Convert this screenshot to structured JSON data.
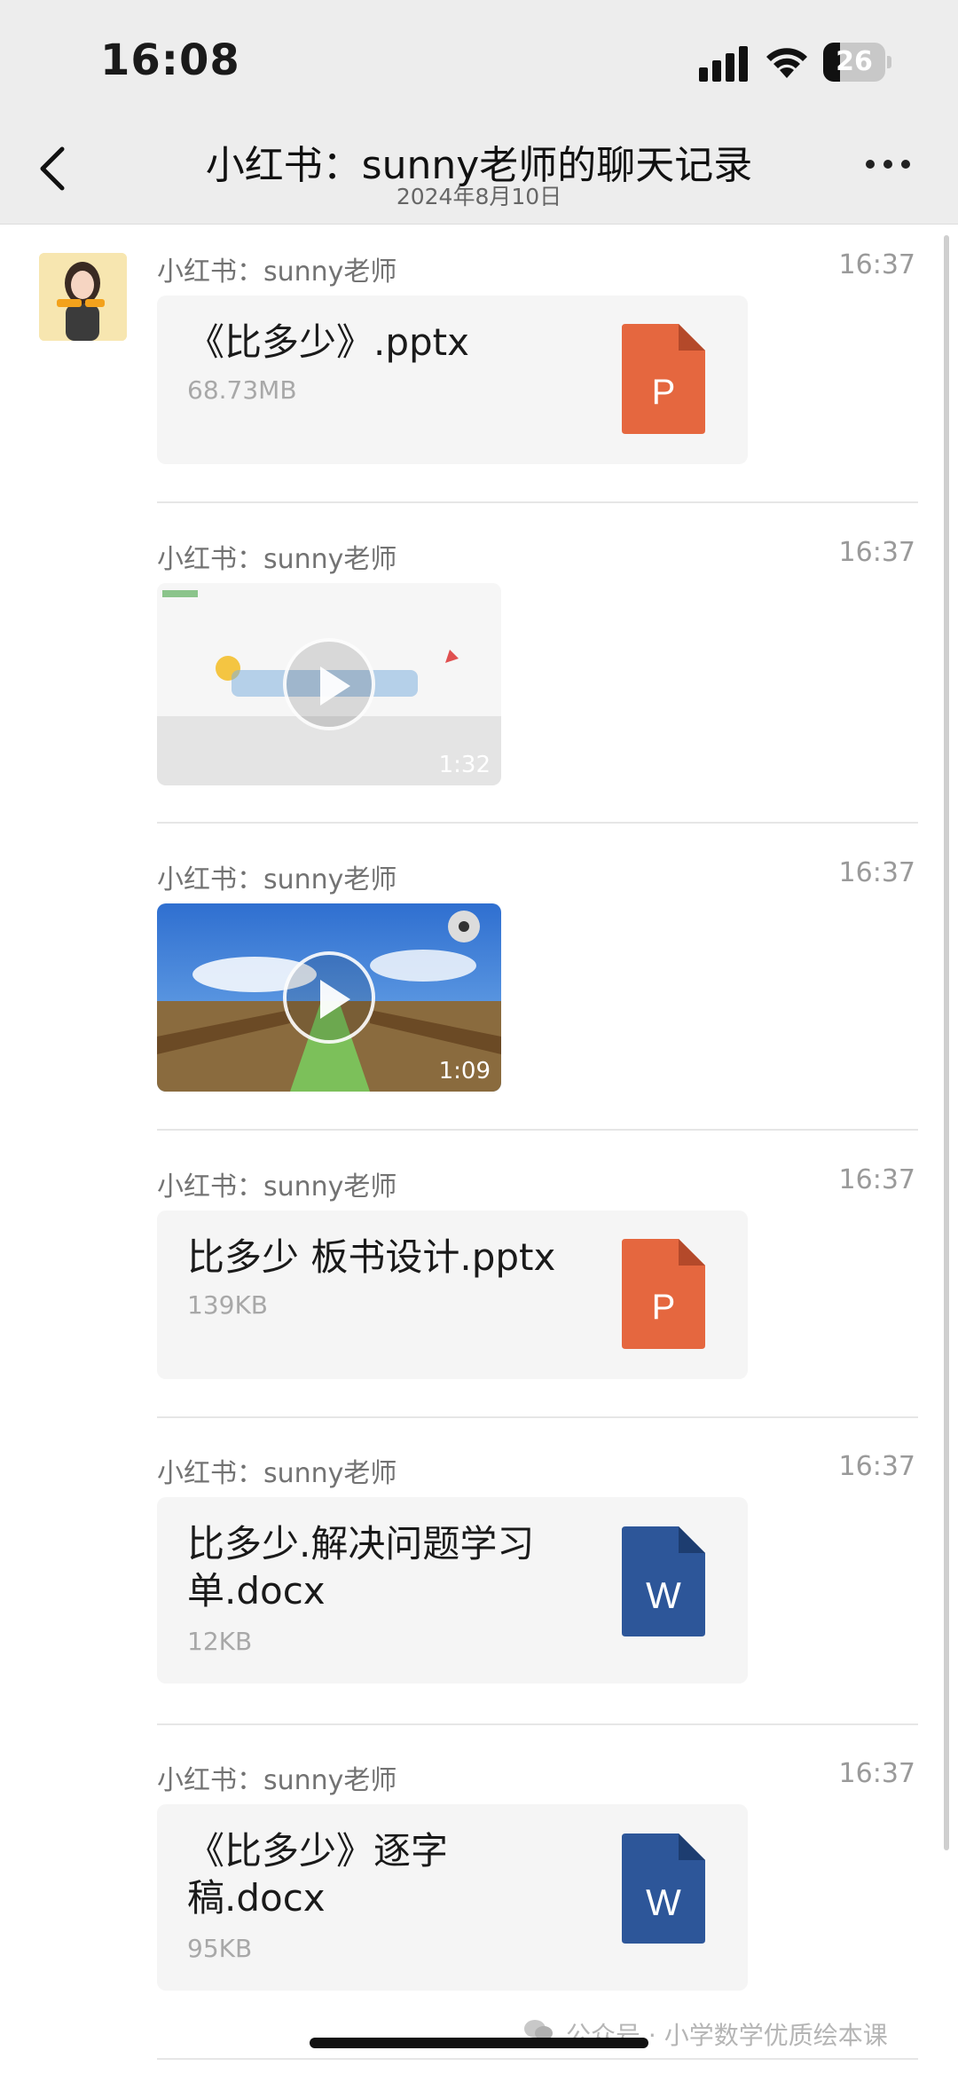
{
  "status_bar": {
    "time": "16:08",
    "battery": "26"
  },
  "header": {
    "title": "小红书：sunny老师的聊天记录",
    "subtitle": "2024年8月10日"
  },
  "messages": [
    {
      "sender": "小红书：sunny老师",
      "time": "16:37",
      "type": "file",
      "name": "《比多少》.pptx",
      "size": "68.73MB",
      "icon": "P"
    },
    {
      "sender": "小红书：sunny老师",
      "time": "16:37",
      "type": "video",
      "duration": "1:32"
    },
    {
      "sender": "小红书：sunny老师",
      "time": "16:37",
      "type": "video",
      "duration": "1:09"
    },
    {
      "sender": "小红书：sunny老师",
      "time": "16:37",
      "type": "file",
      "name": "比多少 板书设计.pptx",
      "size": "139KB",
      "icon": "P"
    },
    {
      "sender": "小红书：sunny老师",
      "time": "16:37",
      "type": "file",
      "name": "比多少.解决问题学习单.docx",
      "size": "12KB",
      "icon": "W"
    },
    {
      "sender": "小红书：sunny老师",
      "time": "16:37",
      "type": "file",
      "name": "《比多少》逐字稿.docx",
      "size": "95KB",
      "icon": "W"
    }
  ],
  "watermark": "公众号 · 小学数学优质绘本课",
  "colors": {
    "ppt": "#e5673f",
    "word": "#2d5699",
    "bar": "#ededed"
  }
}
